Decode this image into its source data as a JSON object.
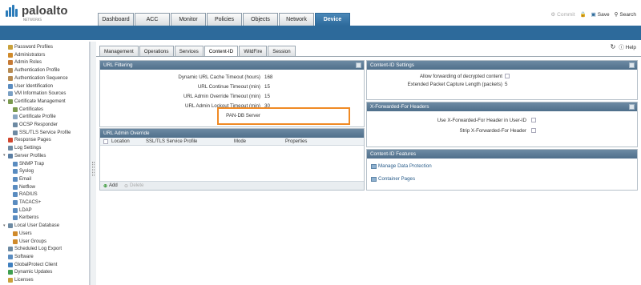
{
  "brand": {
    "name": "paloalto",
    "tagline": "NETWORKS"
  },
  "nav_tabs": [
    "Dashboard",
    "ACC",
    "Monitor",
    "Policies",
    "Objects",
    "Network",
    "Device"
  ],
  "active_nav": "Device",
  "top_actions": {
    "commit": "Commit",
    "save": "Save",
    "search": "Search"
  },
  "header": {
    "help": "Help"
  },
  "sub_tabs": [
    "Management",
    "Operations",
    "Services",
    "Content-ID",
    "WildFire",
    "Session"
  ],
  "active_sub_tab": "Content-ID",
  "sidebar": {
    "items": [
      {
        "label": "Password Profiles",
        "indent": 1,
        "icon": "lock-icon",
        "color": "#c9a13b"
      },
      {
        "label": "Administrators",
        "indent": 1,
        "icon": "user-icon",
        "color": "#d08a2a"
      },
      {
        "label": "Admin Roles",
        "indent": 1,
        "icon": "role-icon",
        "color": "#c67a35"
      },
      {
        "label": "Authentication Profile",
        "indent": 1,
        "icon": "auth-icon",
        "color": "#b78b52"
      },
      {
        "label": "Authentication Sequence",
        "indent": 1,
        "icon": "auth-seq-icon",
        "color": "#b78b52"
      },
      {
        "label": "User Identification",
        "indent": 1,
        "icon": "user-id-icon",
        "color": "#5a8cc0"
      },
      {
        "label": "VM Information Sources",
        "indent": 1,
        "icon": "vm-icon",
        "color": "#7aa0c4"
      },
      {
        "label": "Certificate Management",
        "indent": 0,
        "icon": "cert-icon",
        "color": "#7b9a4e",
        "twisty": "▾"
      },
      {
        "label": "Certificates",
        "indent": 2,
        "icon": "certificate-icon",
        "color": "#7b9a4e"
      },
      {
        "label": "Certificate Profile",
        "indent": 2,
        "icon": "cert-profile-icon",
        "color": "#8aa7c2"
      },
      {
        "label": "OCSP Responder",
        "indent": 2,
        "icon": "ocsp-icon",
        "color": "#6d8aa3"
      },
      {
        "label": "SSL/TLS Service Profile",
        "indent": 2,
        "icon": "ssl-icon",
        "color": "#6d8aa3"
      },
      {
        "label": "Response Pages",
        "indent": 1,
        "icon": "page-icon",
        "color": "#d1472f"
      },
      {
        "label": "Log Settings",
        "indent": 1,
        "icon": "log-icon",
        "color": "#6d8aa3"
      },
      {
        "label": "Server Profiles",
        "indent": 0,
        "icon": "server-icon",
        "color": "#5a7ea3",
        "twisty": "▾"
      },
      {
        "label": "SNMP Trap",
        "indent": 2,
        "icon": "snmp-icon",
        "color": "#5a8cc0"
      },
      {
        "label": "Syslog",
        "indent": 2,
        "icon": "syslog-icon",
        "color": "#5a8cc0"
      },
      {
        "label": "Email",
        "indent": 2,
        "icon": "email-icon",
        "color": "#5a8cc0"
      },
      {
        "label": "Netflow",
        "indent": 2,
        "icon": "netflow-icon",
        "color": "#5a8cc0"
      },
      {
        "label": "RADIUS",
        "indent": 2,
        "icon": "radius-icon",
        "color": "#5a8cc0"
      },
      {
        "label": "TACACS+",
        "indent": 2,
        "icon": "tacacs-icon",
        "color": "#5a8cc0"
      },
      {
        "label": "LDAP",
        "indent": 2,
        "icon": "ldap-icon",
        "color": "#5a8cc0"
      },
      {
        "label": "Kerberos",
        "indent": 2,
        "icon": "kerberos-icon",
        "color": "#5a8cc0"
      },
      {
        "label": "Local User Database",
        "indent": 0,
        "icon": "database-icon",
        "color": "#6d8aa3",
        "twisty": "▾"
      },
      {
        "label": "Users",
        "indent": 2,
        "icon": "user-icon",
        "color": "#d08a2a"
      },
      {
        "label": "User Groups",
        "indent": 2,
        "icon": "group-icon",
        "color": "#d08a2a"
      },
      {
        "label": "Scheduled Log Export",
        "indent": 1,
        "icon": "export-icon",
        "color": "#6d8aa3"
      },
      {
        "label": "Software",
        "indent": 1,
        "icon": "software-icon",
        "color": "#5a8cc0"
      },
      {
        "label": "GlobalProtect Client",
        "indent": 1,
        "icon": "globalprotect-icon",
        "color": "#3f7fbf"
      },
      {
        "label": "Dynamic Updates",
        "indent": 1,
        "icon": "update-icon",
        "color": "#3f9f4f"
      },
      {
        "label": "Licenses",
        "indent": 1,
        "icon": "license-icon",
        "color": "#c9a13b"
      }
    ]
  },
  "url_filtering": {
    "title": "URL Filtering",
    "rows": [
      {
        "label": "Dynamic URL Cache Timeout (hours)",
        "value": "168"
      },
      {
        "label": "URL Continue Timeout (min)",
        "value": "15"
      },
      {
        "label": "URL Admin Override Timeout (min)",
        "value": "15"
      },
      {
        "label": "URL Admin Lockout Timeout (min)",
        "value": "30"
      },
      {
        "label": "PAN-DB Server",
        "value": ""
      }
    ]
  },
  "url_admin_override": {
    "title": "URL Admin Override",
    "columns": [
      "Location",
      "SSL/TLS Service Profile",
      "Mode",
      "Properties"
    ],
    "add": "Add",
    "delete": "Delete"
  },
  "content_id_settings": {
    "title": "Content-ID Settings",
    "rows": [
      {
        "label": "Allow forwarding of decrypted content",
        "value": ""
      },
      {
        "label": "Extended Packet Capture Length (packets)",
        "value": "5"
      }
    ]
  },
  "xff_headers": {
    "title": "X-Forwarded-For Headers",
    "rows": [
      {
        "label": "Use X-Forwarded-For Header in User-ID"
      },
      {
        "label": "Strip X-Forwarded-For Header"
      }
    ]
  },
  "content_id_features": {
    "title": "Content-ID Features",
    "links": [
      "Manage Data Protection",
      "Container Pages"
    ]
  }
}
